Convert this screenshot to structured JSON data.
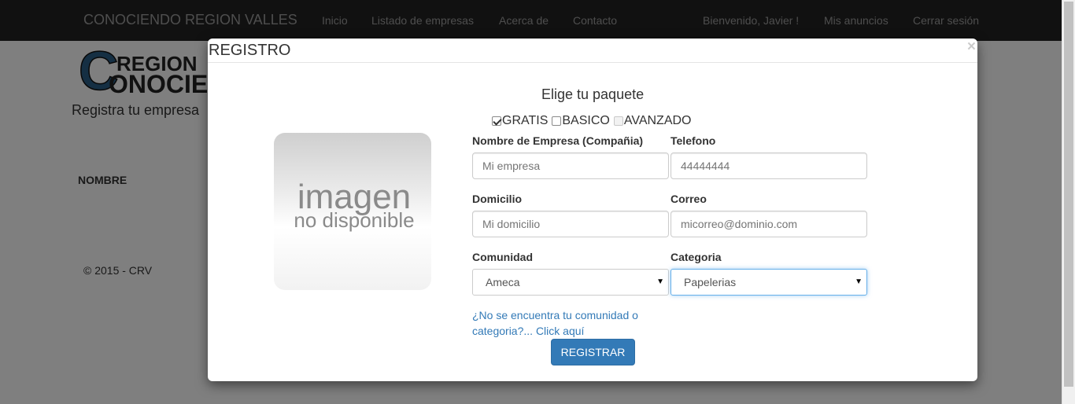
{
  "navbar": {
    "brand": "CONOCIENDO REGION VALLES",
    "links": [
      "Inicio",
      "Listado de empresas",
      "Acerca de",
      "Contacto"
    ],
    "user_links": [
      "Bienvenido, Javier !",
      "Mis anuncios",
      "Cerrar sesión"
    ]
  },
  "page": {
    "logo_text": [
      "REGION",
      "ONOCIE"
    ],
    "subtitle": "Registra tu empresa",
    "column_header": "NOMBRE",
    "footer": "© 2015 - CRV"
  },
  "modal": {
    "title": "REGISTRO",
    "close": "×",
    "image_text": [
      "imagen",
      "no disponible"
    ],
    "package_title": "Elige tu paquete",
    "packages": [
      {
        "label": "GRATIS",
        "checked": true,
        "disabled": false
      },
      {
        "label": "BASICO",
        "checked": false,
        "disabled": false
      },
      {
        "label": "AVANZADO",
        "checked": false,
        "disabled": true
      }
    ],
    "fields": {
      "empresa": {
        "label": "Nombre de Empresa (Compañia)",
        "placeholder": "Mi empresa"
      },
      "telefono": {
        "label": "Telefono",
        "placeholder": "44444444"
      },
      "domicilio": {
        "label": "Domicilio",
        "placeholder": "Mi domicilio"
      },
      "correo": {
        "label": "Correo",
        "placeholder": "micorreo@dominio.com"
      },
      "comunidad": {
        "label": "Comunidad",
        "value": "Ameca"
      },
      "categoria": {
        "label": "Categoria",
        "value": "Papelerias"
      }
    },
    "help_link": "¿No se encuentra tu comunidad o categoria?... Click aquí",
    "register_button": "REGISTRAR"
  },
  "colors": {
    "navbar": "#222222",
    "link": "#337ab7",
    "button": "#337ab7",
    "focus": "#66afe9"
  }
}
